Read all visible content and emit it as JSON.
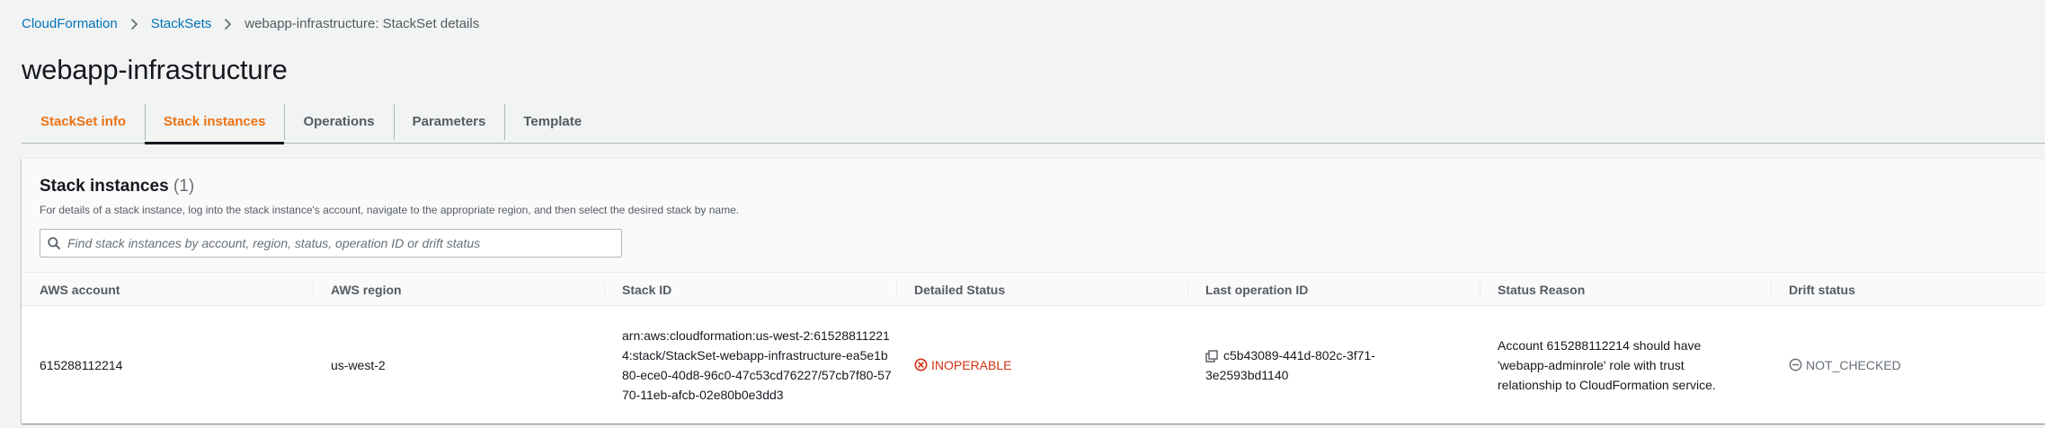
{
  "breadcrumb": {
    "items": [
      "CloudFormation",
      "StackSets"
    ],
    "current": "webapp-infrastructure: StackSet details"
  },
  "page_title": "webapp-infrastructure",
  "tabs": [
    {
      "label": "StackSet info"
    },
    {
      "label": "Stack instances",
      "active": true
    },
    {
      "label": "Operations"
    },
    {
      "label": "Parameters"
    },
    {
      "label": "Template"
    }
  ],
  "instances": {
    "title": "Stack instances",
    "count": "(1)",
    "description": "For details of a stack instance, log into the stack instance's account, navigate to the appropriate region, and then select the desired stack by name.",
    "search_placeholder": "Find stack instances by account, region, status, operation ID or drift status",
    "columns": [
      "AWS account",
      "AWS region",
      "Stack ID",
      "Detailed Status",
      "Last operation ID",
      "Status Reason",
      "Drift status"
    ],
    "rows": [
      {
        "account": "615288112214",
        "region": "us-west-2",
        "stack_id": "arn:aws:cloudformation:us-west-2:615288112214:stack/StackSet-webapp-infrastructure-ea5e1b80-ece0-40d8-96c0-47c53cd76227/57cb7f80-5770-11eb-afcb-02e80b0e3dd3",
        "detailed_status": "INOPERABLE",
        "last_operation_id": "c5b43089-441d-802c-3f71-3e2593bd1140",
        "status_reason": "Account 615288112214 should have 'webapp-adminrole' role with trust relationship to CloudFormation service.",
        "drift_status": "NOT_CHECKED"
      }
    ]
  },
  "colors": {
    "link": "#0073bb",
    "accent": "#ec7211",
    "error": "#d13212",
    "neutral": "#687078"
  }
}
